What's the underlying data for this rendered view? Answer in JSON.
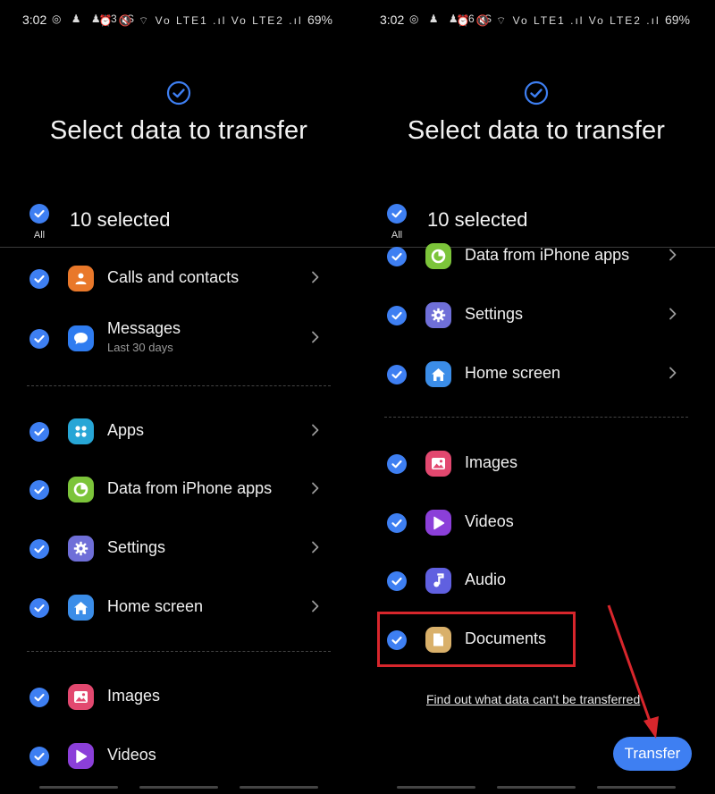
{
  "left": {
    "status": {
      "time": "3:02",
      "notifications": "◎ ♟ ♟ 3 S",
      "system": "⏰ 🔇 ⌔ Vo LTE1 .ıl Vo LTE2 .ıl",
      "battery": "69%"
    },
    "title": "Select data to transfer",
    "select_all_label": "All",
    "selected_count": "10 selected",
    "items": [
      {
        "label": "Calls and contacts",
        "icon": "contacts-icon",
        "color": "#e9782a"
      },
      {
        "label": "Messages",
        "sublabel": "Last 30 days",
        "icon": "messages-icon",
        "color": "#2f7cf0"
      },
      {
        "label": "Apps",
        "icon": "apps-icon",
        "color": "#27a6d6"
      },
      {
        "label": "Data from iPhone apps",
        "icon": "iphone-data-icon",
        "color": "#7cc43a"
      },
      {
        "label": "Settings",
        "icon": "settings-icon",
        "color": "#6f6fd8"
      },
      {
        "label": "Home screen",
        "icon": "home-icon",
        "color": "#3b8de8"
      },
      {
        "label": "Images",
        "icon": "images-icon",
        "color": "#e2486f"
      },
      {
        "label": "Videos",
        "icon": "videos-icon",
        "color": "#8b3fd9"
      }
    ]
  },
  "right": {
    "status": {
      "time": "3:02",
      "notifications": "◎ ♟ ♟ 6 S",
      "system": "⏰ 🔇 ⌔ Vo LTE1 .ıl Vo LTE2 .ıl",
      "battery": "69%"
    },
    "title": "Select data to transfer",
    "select_all_label": "All",
    "selected_count": "10 selected",
    "items": [
      {
        "label": "Data from iPhone apps",
        "icon": "iphone-data-icon",
        "color": "#7cc43a"
      },
      {
        "label": "Settings",
        "icon": "settings-icon",
        "color": "#6f6fd8"
      },
      {
        "label": "Home screen",
        "icon": "home-icon",
        "color": "#3b8de8"
      },
      {
        "label": "Images",
        "icon": "images-icon",
        "color": "#e2486f"
      },
      {
        "label": "Videos",
        "icon": "videos-icon",
        "color": "#8b3fd9"
      },
      {
        "label": "Audio",
        "icon": "audio-icon",
        "color": "#6060e0"
      },
      {
        "label": "Documents",
        "icon": "documents-icon",
        "color": "#d9b06a"
      }
    ],
    "link_text": "Find out what data can't be transferred",
    "transfer_label": "Transfer"
  },
  "colors": {
    "accent": "#3e7ff2",
    "highlight": "#d8262c",
    "background": "#000000"
  }
}
